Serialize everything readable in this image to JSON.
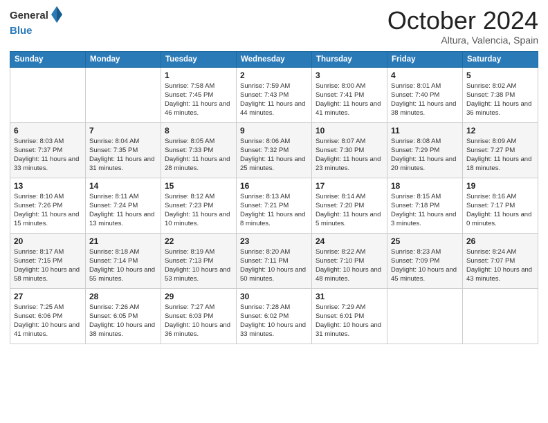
{
  "logo": {
    "general": "General",
    "blue": "Blue"
  },
  "header": {
    "month": "October 2024",
    "location": "Altura, Valencia, Spain"
  },
  "days_of_week": [
    "Sunday",
    "Monday",
    "Tuesday",
    "Wednesday",
    "Thursday",
    "Friday",
    "Saturday"
  ],
  "weeks": [
    [
      {
        "day": "",
        "sunrise": "",
        "sunset": "",
        "daylight": ""
      },
      {
        "day": "",
        "sunrise": "",
        "sunset": "",
        "daylight": ""
      },
      {
        "day": "1",
        "sunrise": "Sunrise: 7:58 AM",
        "sunset": "Sunset: 7:45 PM",
        "daylight": "Daylight: 11 hours and 46 minutes."
      },
      {
        "day": "2",
        "sunrise": "Sunrise: 7:59 AM",
        "sunset": "Sunset: 7:43 PM",
        "daylight": "Daylight: 11 hours and 44 minutes."
      },
      {
        "day": "3",
        "sunrise": "Sunrise: 8:00 AM",
        "sunset": "Sunset: 7:41 PM",
        "daylight": "Daylight: 11 hours and 41 minutes."
      },
      {
        "day": "4",
        "sunrise": "Sunrise: 8:01 AM",
        "sunset": "Sunset: 7:40 PM",
        "daylight": "Daylight: 11 hours and 38 minutes."
      },
      {
        "day": "5",
        "sunrise": "Sunrise: 8:02 AM",
        "sunset": "Sunset: 7:38 PM",
        "daylight": "Daylight: 11 hours and 36 minutes."
      }
    ],
    [
      {
        "day": "6",
        "sunrise": "Sunrise: 8:03 AM",
        "sunset": "Sunset: 7:37 PM",
        "daylight": "Daylight: 11 hours and 33 minutes."
      },
      {
        "day": "7",
        "sunrise": "Sunrise: 8:04 AM",
        "sunset": "Sunset: 7:35 PM",
        "daylight": "Daylight: 11 hours and 31 minutes."
      },
      {
        "day": "8",
        "sunrise": "Sunrise: 8:05 AM",
        "sunset": "Sunset: 7:33 PM",
        "daylight": "Daylight: 11 hours and 28 minutes."
      },
      {
        "day": "9",
        "sunrise": "Sunrise: 8:06 AM",
        "sunset": "Sunset: 7:32 PM",
        "daylight": "Daylight: 11 hours and 25 minutes."
      },
      {
        "day": "10",
        "sunrise": "Sunrise: 8:07 AM",
        "sunset": "Sunset: 7:30 PM",
        "daylight": "Daylight: 11 hours and 23 minutes."
      },
      {
        "day": "11",
        "sunrise": "Sunrise: 8:08 AM",
        "sunset": "Sunset: 7:29 PM",
        "daylight": "Daylight: 11 hours and 20 minutes."
      },
      {
        "day": "12",
        "sunrise": "Sunrise: 8:09 AM",
        "sunset": "Sunset: 7:27 PM",
        "daylight": "Daylight: 11 hours and 18 minutes."
      }
    ],
    [
      {
        "day": "13",
        "sunrise": "Sunrise: 8:10 AM",
        "sunset": "Sunset: 7:26 PM",
        "daylight": "Daylight: 11 hours and 15 minutes."
      },
      {
        "day": "14",
        "sunrise": "Sunrise: 8:11 AM",
        "sunset": "Sunset: 7:24 PM",
        "daylight": "Daylight: 11 hours and 13 minutes."
      },
      {
        "day": "15",
        "sunrise": "Sunrise: 8:12 AM",
        "sunset": "Sunset: 7:23 PM",
        "daylight": "Daylight: 11 hours and 10 minutes."
      },
      {
        "day": "16",
        "sunrise": "Sunrise: 8:13 AM",
        "sunset": "Sunset: 7:21 PM",
        "daylight": "Daylight: 11 hours and 8 minutes."
      },
      {
        "day": "17",
        "sunrise": "Sunrise: 8:14 AM",
        "sunset": "Sunset: 7:20 PM",
        "daylight": "Daylight: 11 hours and 5 minutes."
      },
      {
        "day": "18",
        "sunrise": "Sunrise: 8:15 AM",
        "sunset": "Sunset: 7:18 PM",
        "daylight": "Daylight: 11 hours and 3 minutes."
      },
      {
        "day": "19",
        "sunrise": "Sunrise: 8:16 AM",
        "sunset": "Sunset: 7:17 PM",
        "daylight": "Daylight: 11 hours and 0 minutes."
      }
    ],
    [
      {
        "day": "20",
        "sunrise": "Sunrise: 8:17 AM",
        "sunset": "Sunset: 7:15 PM",
        "daylight": "Daylight: 10 hours and 58 minutes."
      },
      {
        "day": "21",
        "sunrise": "Sunrise: 8:18 AM",
        "sunset": "Sunset: 7:14 PM",
        "daylight": "Daylight: 10 hours and 55 minutes."
      },
      {
        "day": "22",
        "sunrise": "Sunrise: 8:19 AM",
        "sunset": "Sunset: 7:13 PM",
        "daylight": "Daylight: 10 hours and 53 minutes."
      },
      {
        "day": "23",
        "sunrise": "Sunrise: 8:20 AM",
        "sunset": "Sunset: 7:11 PM",
        "daylight": "Daylight: 10 hours and 50 minutes."
      },
      {
        "day": "24",
        "sunrise": "Sunrise: 8:22 AM",
        "sunset": "Sunset: 7:10 PM",
        "daylight": "Daylight: 10 hours and 48 minutes."
      },
      {
        "day": "25",
        "sunrise": "Sunrise: 8:23 AM",
        "sunset": "Sunset: 7:09 PM",
        "daylight": "Daylight: 10 hours and 45 minutes."
      },
      {
        "day": "26",
        "sunrise": "Sunrise: 8:24 AM",
        "sunset": "Sunset: 7:07 PM",
        "daylight": "Daylight: 10 hours and 43 minutes."
      }
    ],
    [
      {
        "day": "27",
        "sunrise": "Sunrise: 7:25 AM",
        "sunset": "Sunset: 6:06 PM",
        "daylight": "Daylight: 10 hours and 41 minutes."
      },
      {
        "day": "28",
        "sunrise": "Sunrise: 7:26 AM",
        "sunset": "Sunset: 6:05 PM",
        "daylight": "Daylight: 10 hours and 38 minutes."
      },
      {
        "day": "29",
        "sunrise": "Sunrise: 7:27 AM",
        "sunset": "Sunset: 6:03 PM",
        "daylight": "Daylight: 10 hours and 36 minutes."
      },
      {
        "day": "30",
        "sunrise": "Sunrise: 7:28 AM",
        "sunset": "Sunset: 6:02 PM",
        "daylight": "Daylight: 10 hours and 33 minutes."
      },
      {
        "day": "31",
        "sunrise": "Sunrise: 7:29 AM",
        "sunset": "Sunset: 6:01 PM",
        "daylight": "Daylight: 10 hours and 31 minutes."
      },
      {
        "day": "",
        "sunrise": "",
        "sunset": "",
        "daylight": ""
      },
      {
        "day": "",
        "sunrise": "",
        "sunset": "",
        "daylight": ""
      }
    ]
  ]
}
